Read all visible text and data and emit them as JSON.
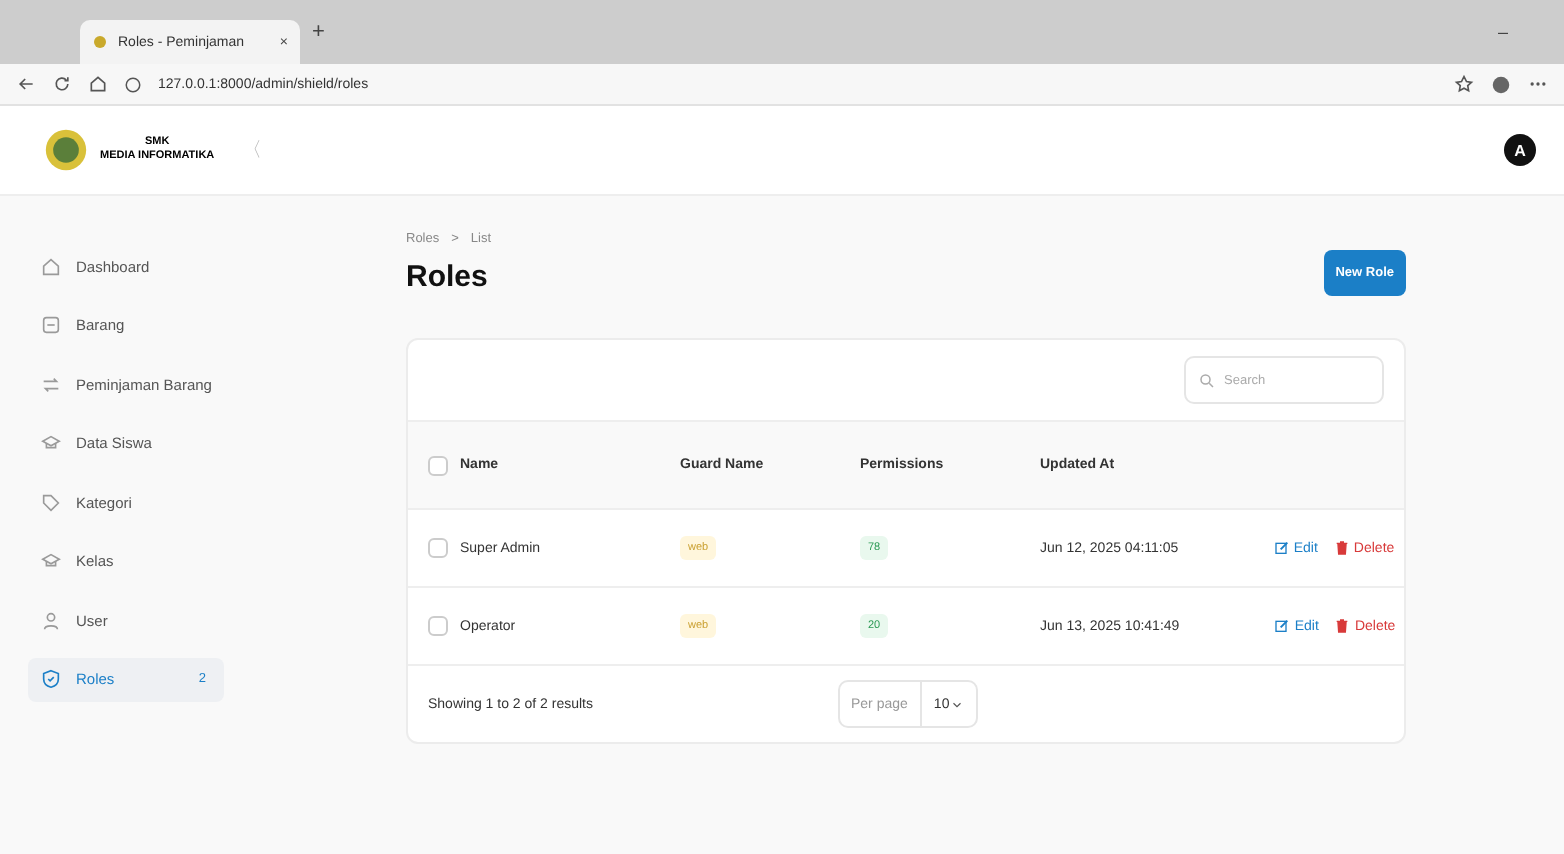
{
  "browser": {
    "tab_title": "Roles - Peminjaman",
    "tab_close": "×",
    "new_tab": "+",
    "url": "127.0.0.1:8000/admin/shield/roles",
    "minimize": "–"
  },
  "header": {
    "brand_top": "SMK",
    "brand_bottom": "MEDIA INFORMATIKA",
    "collapse": "〈",
    "avatar": "A"
  },
  "sidebar": {
    "items": [
      {
        "label": "Dashboard",
        "selected": false
      },
      {
        "label": "Barang",
        "selected": false
      },
      {
        "label": "Peminjaman Barang",
        "selected": false
      },
      {
        "label": "Data Siswa",
        "selected": false
      },
      {
        "label": "Kategori",
        "selected": false
      },
      {
        "label": "Kelas",
        "selected": false
      },
      {
        "label": "User",
        "selected": false
      },
      {
        "label": "Roles",
        "selected": true,
        "badge": "2"
      }
    ]
  },
  "page": {
    "breadcrumbs": [
      "Roles",
      "List"
    ],
    "breadcrumb_separator": ">",
    "title": "Roles",
    "new_button": "New Role"
  },
  "table": {
    "search": {
      "placeholder": "Search"
    },
    "select_all_checked": false,
    "columns": [
      "Name",
      "Guard Name",
      "Permissions",
      "Updated At"
    ],
    "rows": [
      {
        "name": "Super Admin",
        "guard": "web",
        "permissions": "78",
        "updated": "Jun 12, 2025 04:11:05",
        "checked": false,
        "actions": [
          "Edit",
          "Delete"
        ]
      },
      {
        "name": "Operator",
        "guard": "web",
        "permissions": "20",
        "updated": "Jun 13, 2025 10:41:49",
        "checked": false,
        "actions": [
          "Edit",
          "Delete"
        ]
      }
    ],
    "footer": {
      "summary": "Showing 1 to 2 of 2 results",
      "per_page_label": "Per page",
      "per_page": "10"
    }
  }
}
